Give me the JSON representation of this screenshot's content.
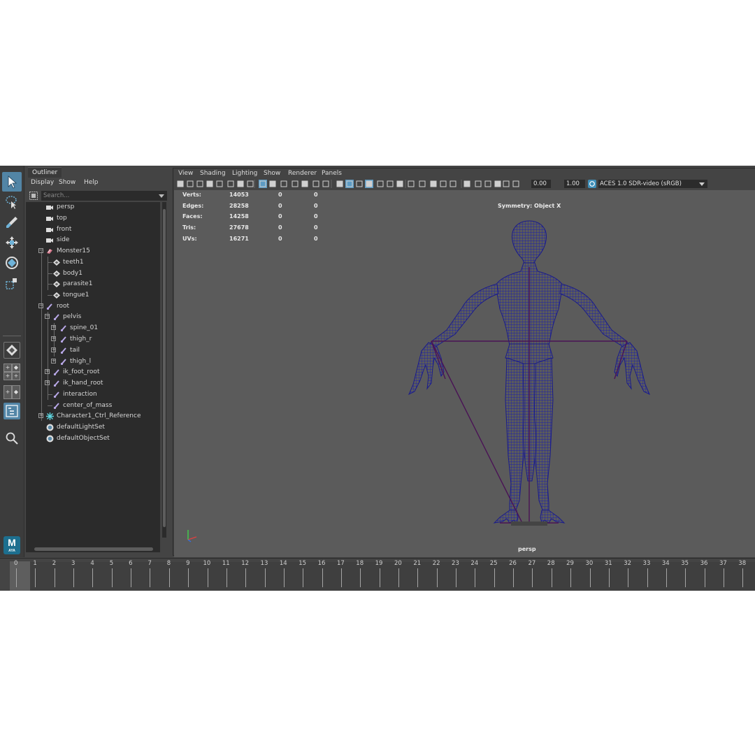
{
  "outliner": {
    "tab": "Outliner",
    "menu": [
      "Display",
      "Show",
      "Help"
    ],
    "search_placeholder": "Search...",
    "items": [
      {
        "label": "persp",
        "icon": "camera-icon"
      },
      {
        "label": "top",
        "icon": "camera-icon"
      },
      {
        "label": "front",
        "icon": "camera-icon"
      },
      {
        "label": "side",
        "icon": "camera-icon"
      },
      {
        "label": "Monster15",
        "icon": "group-icon"
      },
      {
        "label": "teeth1",
        "icon": "mesh-icon"
      },
      {
        "label": "body1",
        "icon": "mesh-icon"
      },
      {
        "label": "parasite1",
        "icon": "mesh-icon"
      },
      {
        "label": "tongue1",
        "icon": "mesh-icon"
      },
      {
        "label": "root",
        "icon": "joint-icon"
      },
      {
        "label": "pelvis",
        "icon": "joint-icon"
      },
      {
        "label": "spine_01",
        "icon": "joint-icon"
      },
      {
        "label": "thigh_r",
        "icon": "joint-icon"
      },
      {
        "label": "tail",
        "icon": "joint-icon"
      },
      {
        "label": "thigh_l",
        "icon": "joint-icon"
      },
      {
        "label": "ik_foot_root",
        "icon": "joint-icon"
      },
      {
        "label": "ik_hand_root",
        "icon": "joint-icon"
      },
      {
        "label": "interaction",
        "icon": "joint-icon"
      },
      {
        "label": "center_of_mass",
        "icon": "joint-icon"
      },
      {
        "label": "Character1_Ctrl_Reference",
        "icon": "hik-reference-icon"
      },
      {
        "label": "defaultLightSet",
        "icon": "set-icon"
      },
      {
        "label": "defaultObjectSet",
        "icon": "set-icon"
      }
    ]
  },
  "viewport": {
    "menu": [
      "View",
      "Shading",
      "Lighting",
      "Show",
      "Renderer",
      "Panels"
    ],
    "exposure_value": "0.00",
    "gamma_value": "1.00",
    "color_space": "ACES 1.0 SDR-video (sRGB)",
    "symmetry_label": "Symmetry: Object X",
    "camera_label": "persp",
    "hud": {
      "rows": [
        {
          "label": "Verts:",
          "v1": "14053",
          "v2": "0",
          "v3": "0"
        },
        {
          "label": "Edges:",
          "v1": "28258",
          "v2": "0",
          "v3": "0"
        },
        {
          "label": "Faces:",
          "v1": "14258",
          "v2": "0",
          "v3": "0"
        },
        {
          "label": "Tris:",
          "v1": "27678",
          "v2": "0",
          "v3": "0"
        },
        {
          "label": "UVs:",
          "v1": "16271",
          "v2": "0",
          "v3": "0"
        }
      ]
    }
  },
  "timeline": {
    "frames": [
      "0",
      "1",
      "2",
      "3",
      "4",
      "5",
      "6",
      "7",
      "8",
      "9",
      "10",
      "11",
      "12",
      "13",
      "14",
      "15",
      "16",
      "17",
      "18",
      "19",
      "20",
      "21",
      "22",
      "23",
      "24",
      "25",
      "26",
      "27",
      "28",
      "29",
      "30",
      "31",
      "32",
      "33",
      "34",
      "35",
      "36",
      "37",
      "38"
    ],
    "current_frame": "0"
  },
  "logo": {
    "letter": "M",
    "sub": "AYA"
  },
  "colors": {
    "accent": "#5285a6",
    "mesh": "#2b2e9e",
    "joint": "#5a1a5a",
    "panel": "#444444",
    "viewport_bg": "#5b5b5b"
  }
}
